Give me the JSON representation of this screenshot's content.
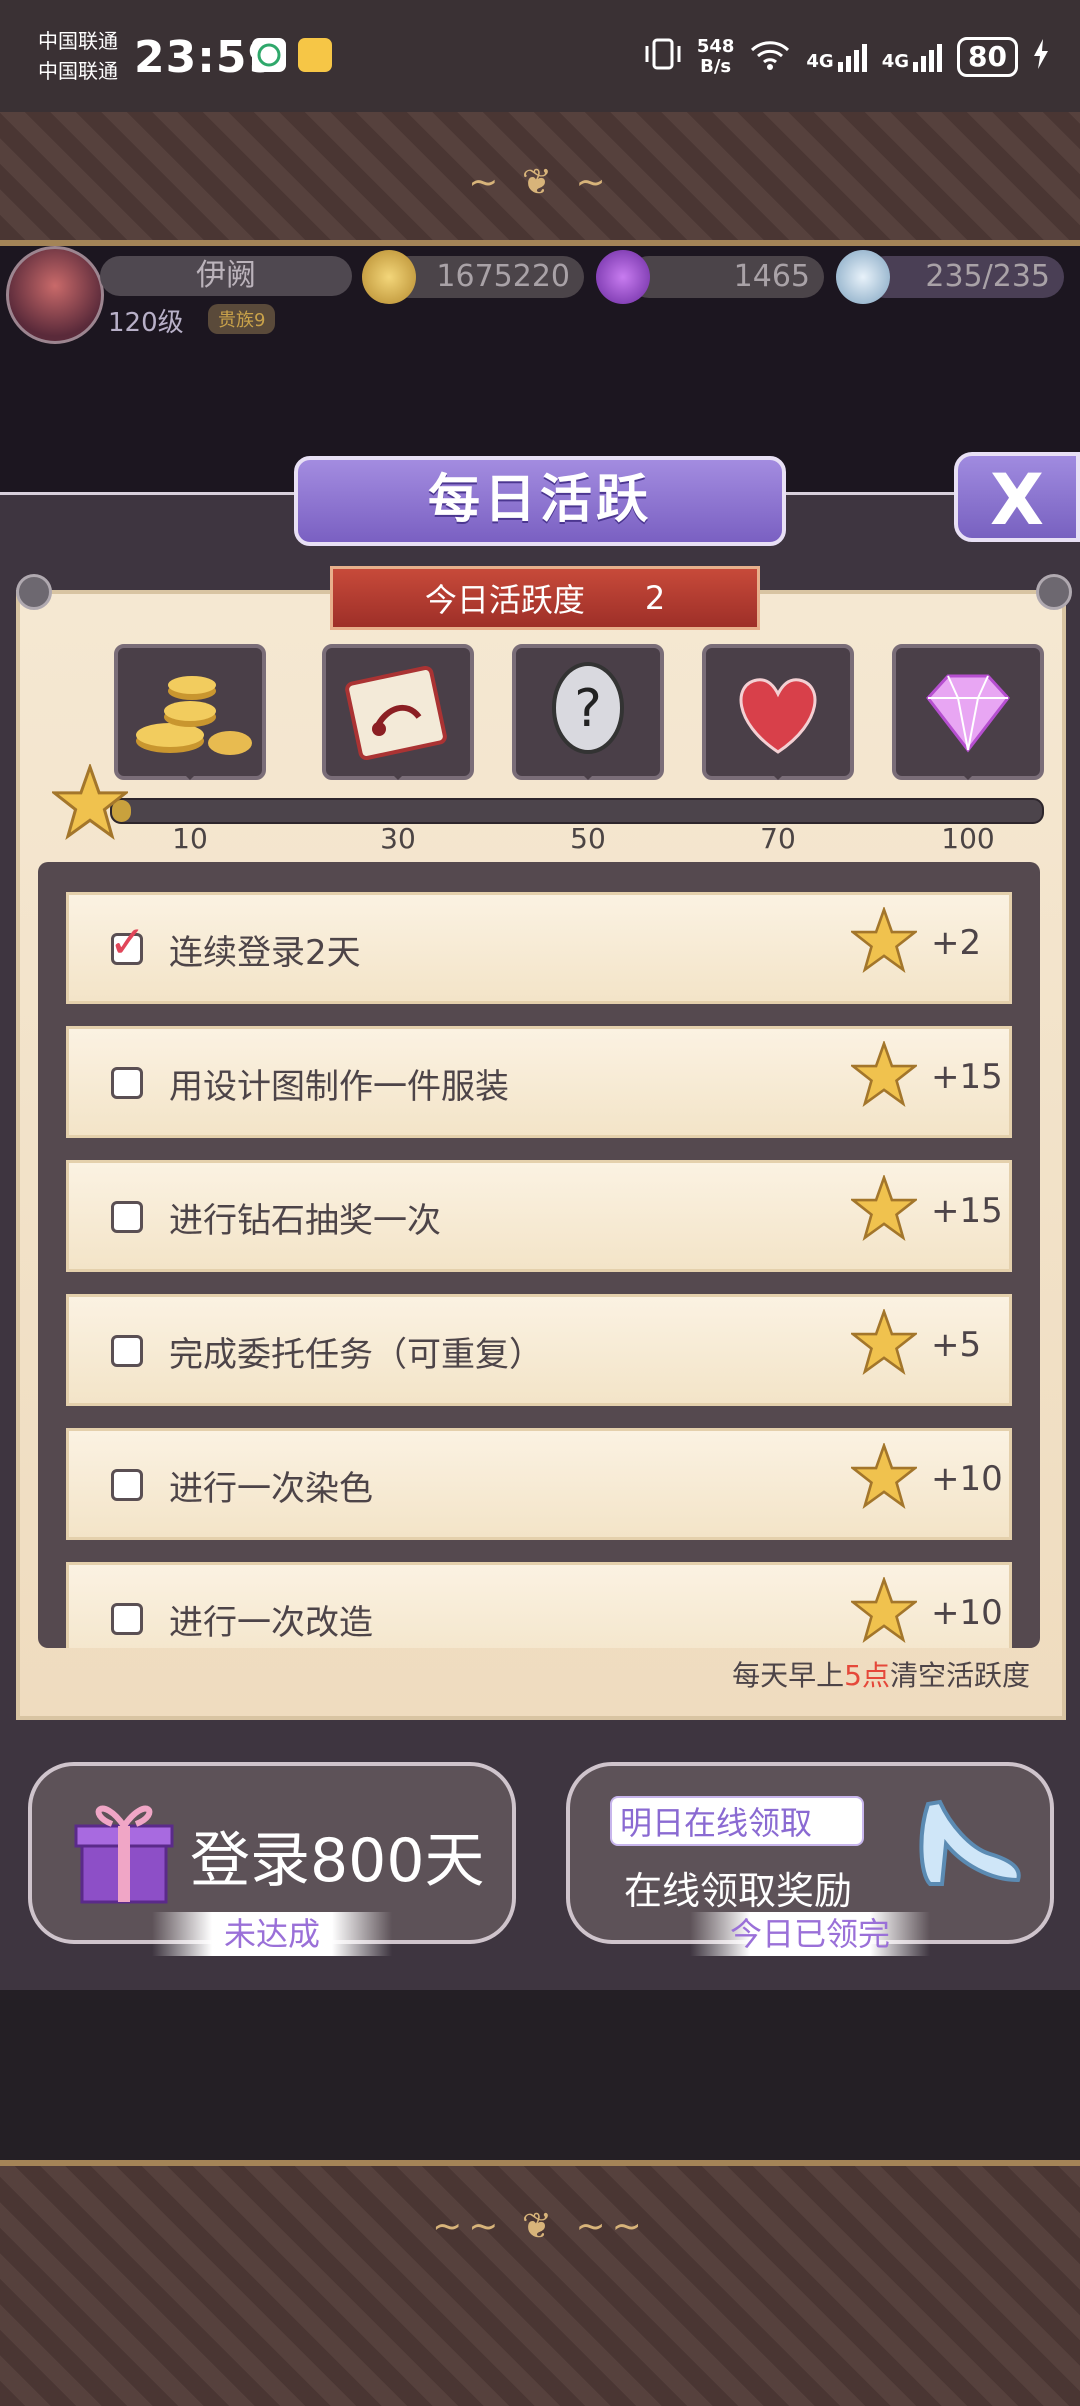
{
  "status_bar": {
    "carrier1": "中国联通",
    "carrier2": "中国联通",
    "time": "23:59",
    "net_speed_value": "548",
    "net_speed_unit": "B/s",
    "signal1": "4G",
    "signal2": "4G",
    "battery": "80"
  },
  "player": {
    "name": "伊阙",
    "level": "120级",
    "tag": "贵族9"
  },
  "resources": {
    "gold": "1675220",
    "diamond": "1465",
    "stamina": "235/235"
  },
  "dialog": {
    "title": "每日活跃",
    "close_label": "X",
    "activity_label": "今日活跃度",
    "activity_value": "2",
    "progress_fraction": 0.02,
    "milestones": [
      "10",
      "30",
      "50",
      "70",
      "100"
    ],
    "reward_icons": [
      "gold-coins-icon",
      "design-scroll-icon",
      "mystery-question-icon",
      "heart-icon",
      "diamond-icon"
    ],
    "tasks": [
      {
        "label": "连续登录2天",
        "points": "+2",
        "done": true
      },
      {
        "label": "用设计图制作一件服装",
        "points": "+15",
        "done": false
      },
      {
        "label": "进行钻石抽奖一次",
        "points": "+15",
        "done": false
      },
      {
        "label": "完成委托任务（可重复）",
        "points": "+5",
        "done": false
      },
      {
        "label": "进行一次染色",
        "points": "+10",
        "done": false
      },
      {
        "label": "进行一次改造",
        "points": "+10",
        "done": false
      }
    ],
    "reset_note_prefix": "每天早上",
    "reset_note_hour": "5点",
    "reset_note_suffix": "清空活跃度"
  },
  "login_card": {
    "title": "登录800天",
    "status": "未达成"
  },
  "online_card": {
    "pill": "明日在线领取",
    "subtitle": "在线领取奖励",
    "status": "今日已领完"
  },
  "colors": {
    "accent_purple": "#8b72d4",
    "banner_red": "#b23a30",
    "highlight_red": "#e5483a",
    "check_red": "#e1465a"
  }
}
